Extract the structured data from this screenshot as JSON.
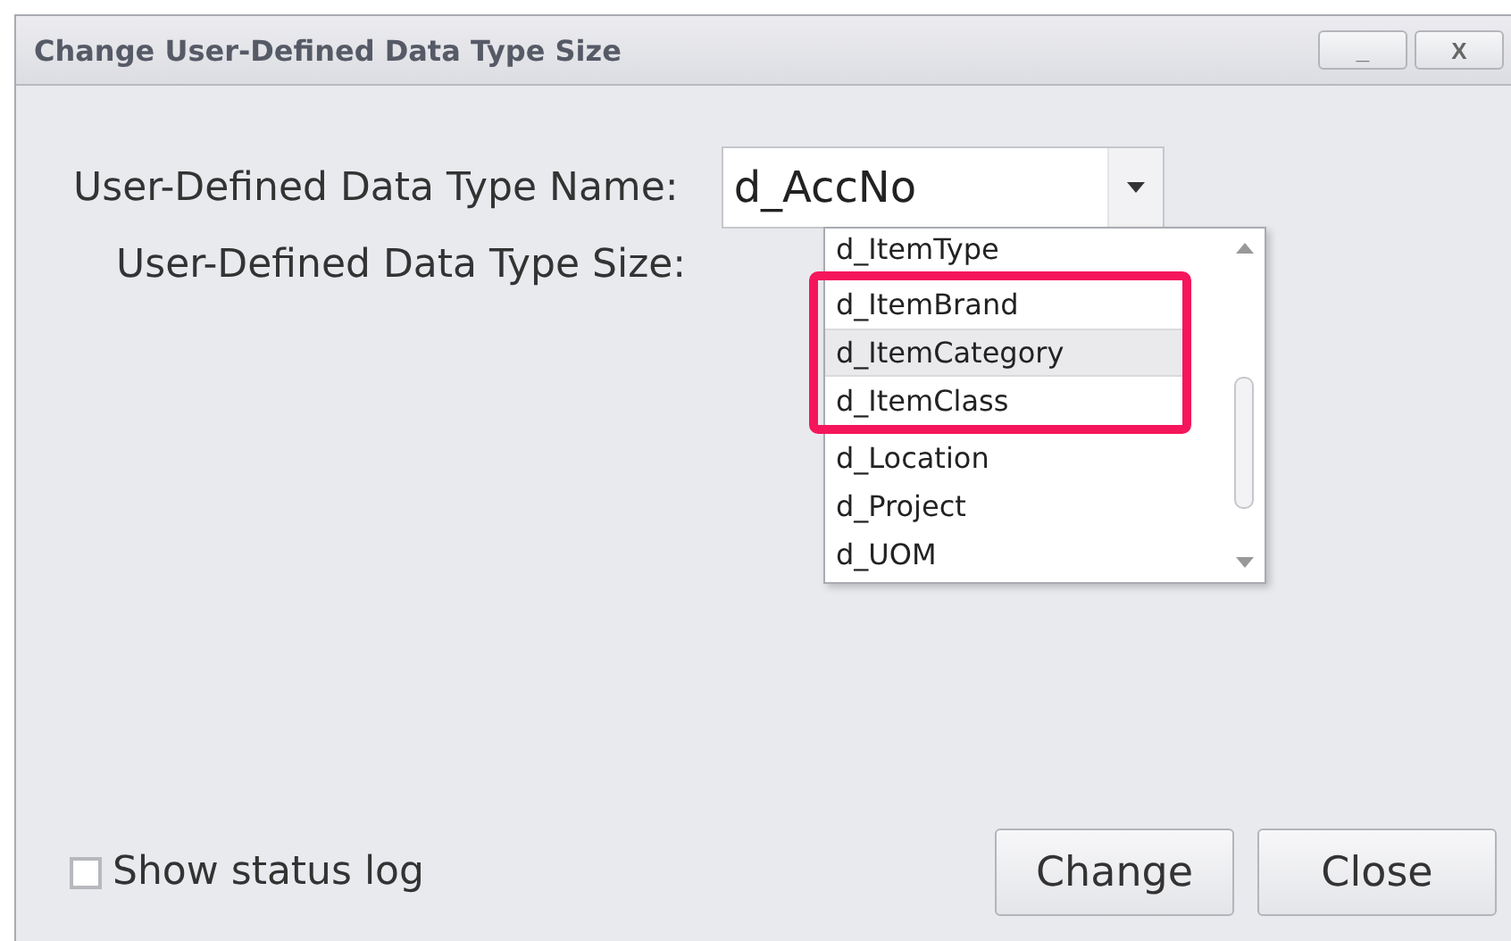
{
  "window": {
    "title": "Change User-Defined Data Type Size",
    "buttons": [
      "_",
      "X"
    ]
  },
  "name_label": "User-Defined Data Type Name:",
  "combo": {
    "value": "d_AccNo",
    "expanded": true
  },
  "size_label": "User-Defined Data Type Size:",
  "dropdown_items": [
    {
      "label": "d_ItemType",
      "selected": false
    },
    {
      "label": "d_ItemBrand",
      "selected": false
    },
    {
      "label": "d_ItemCategory",
      "selected": true
    },
    {
      "label": "d_ItemClass",
      "selected": false
    },
    {
      "label": "d_Location",
      "selected": false
    },
    {
      "label": "d_Project",
      "selected": false
    },
    {
      "label": "d_UOM",
      "selected": false
    }
  ],
  "highlight": {
    "color": "#f5155b"
  },
  "show_status_log": {
    "label": "Show status log",
    "checked": false
  },
  "actions": [
    "Change",
    "Close"
  ]
}
